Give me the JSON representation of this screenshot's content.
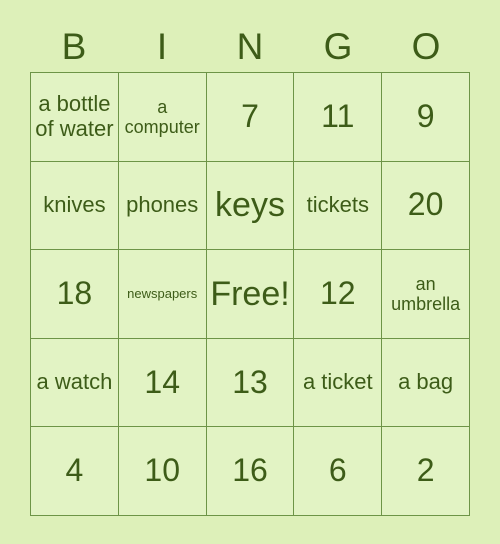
{
  "card": {
    "title": "BINGO",
    "headers": [
      "B",
      "I",
      "N",
      "G",
      "O"
    ],
    "colors": {
      "page_background": "#ddf0b9",
      "cell_background": "#e2f3c4",
      "border": "#6d9447",
      "text": "#3d5c18"
    },
    "free_space": "Free!",
    "rows": [
      [
        {
          "text": "a bottle of water",
          "size": "md"
        },
        {
          "text": "a computer",
          "size": "sm"
        },
        {
          "text": "7",
          "size": "lg"
        },
        {
          "text": "11",
          "size": "lg"
        },
        {
          "text": "9",
          "size": "lg"
        }
      ],
      [
        {
          "text": "knives",
          "size": "md"
        },
        {
          "text": "phones",
          "size": "md"
        },
        {
          "text": "keys",
          "size": "xl"
        },
        {
          "text": "tickets",
          "size": "md"
        },
        {
          "text": "20",
          "size": "lg"
        }
      ],
      [
        {
          "text": "18",
          "size": "lg"
        },
        {
          "text": "newspapers",
          "size": "xs"
        },
        {
          "text": "Free!",
          "size": "xl"
        },
        {
          "text": "12",
          "size": "lg"
        },
        {
          "text": "an umbrella",
          "size": "sm"
        }
      ],
      [
        {
          "text": "a watch",
          "size": "md"
        },
        {
          "text": "14",
          "size": "lg"
        },
        {
          "text": "13",
          "size": "lg"
        },
        {
          "text": "a ticket",
          "size": "md"
        },
        {
          "text": "a bag",
          "size": "md"
        }
      ],
      [
        {
          "text": "4",
          "size": "lg"
        },
        {
          "text": "10",
          "size": "lg"
        },
        {
          "text": "16",
          "size": "lg"
        },
        {
          "text": "6",
          "size": "lg"
        },
        {
          "text": "2",
          "size": "lg"
        }
      ]
    ]
  }
}
